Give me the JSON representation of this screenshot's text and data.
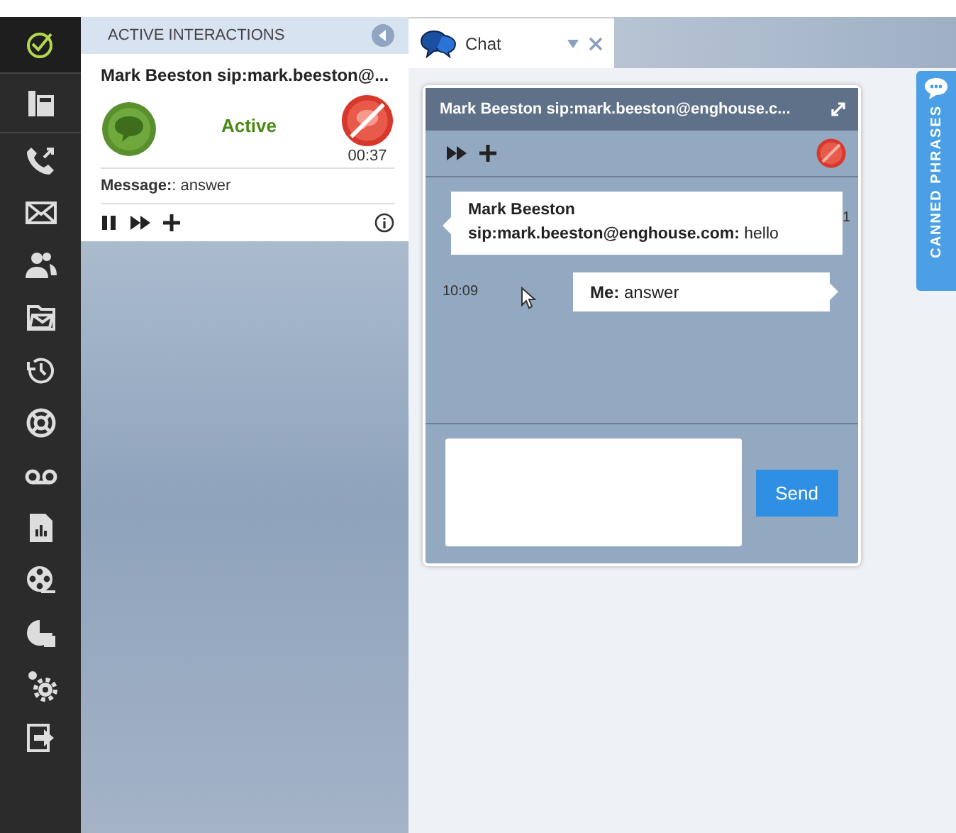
{
  "sidebar": {
    "items": [
      {
        "selected": true
      },
      {
        "selected": false
      },
      {
        "selected": false
      },
      {
        "selected": false
      },
      {
        "selected": false
      },
      {
        "selected": false
      },
      {
        "selected": false
      },
      {
        "selected": false
      },
      {
        "selected": false
      },
      {
        "selected": false
      },
      {
        "selected": false
      },
      {
        "selected": false
      },
      {
        "selected": false
      },
      {
        "selected": false
      }
    ]
  },
  "interactions_panel": {
    "title": "ACTIVE INTERACTIONS",
    "card": {
      "contact": "Mark Beeston sip:mark.beeston@...",
      "status": "Active",
      "timer": "00:37",
      "message_label": "Message:",
      "message": ": answer"
    }
  },
  "tabs": [
    {
      "label": "Chat",
      "selected": true
    }
  ],
  "chat": {
    "title": "Mark Beeston sip:mark.beeston@enghouse.c...",
    "messages": [
      {
        "kind": "incoming",
        "sender": "Mark Beeston sip:mark.beeston@enghouse.com:",
        "text": "hello",
        "time": "1"
      },
      {
        "kind": "outgoing",
        "sender": "Me:",
        "text": "answer",
        "time": "10:09"
      }
    ],
    "send_button": "Send"
  },
  "canned_phrases": {
    "label": "CANNED PHRASES"
  }
}
